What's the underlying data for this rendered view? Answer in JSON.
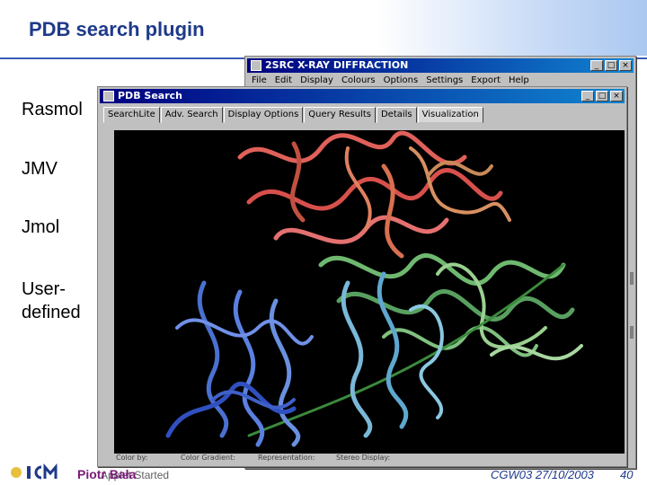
{
  "slide": {
    "title": "PDB search plugin",
    "side_items": [
      "Rasmol",
      "JMV",
      "Jmol",
      "User-",
      "defined"
    ]
  },
  "back_window": {
    "title": "2SRC X-RAY DIFFRACTION",
    "menu": [
      "File",
      "Edit",
      "Display",
      "Colours",
      "Options",
      "Settings",
      "Export",
      "Help"
    ],
    "controls": [
      "_",
      "□",
      "×"
    ]
  },
  "front_window": {
    "title": "PDB Search",
    "controls": [
      "_",
      "□",
      "×"
    ],
    "tabs": [
      "SearchLite",
      "Adv. Search",
      "Display Options",
      "Query Results",
      "Details",
      "Visualization"
    ],
    "active_tab": "Visualization",
    "bottom_labels": [
      "Color by:",
      "Color Gradient:",
      "Representation:",
      "Stereo Display:"
    ]
  },
  "footer": {
    "author": "Piotr Bała",
    "applet_status": "Applet Started",
    "conference": "CGW03 27/10/2003",
    "page": "40"
  },
  "colors": {
    "title": "#1f3a8a",
    "author": "#7a1a7a",
    "conference": "#1f3a8a"
  }
}
